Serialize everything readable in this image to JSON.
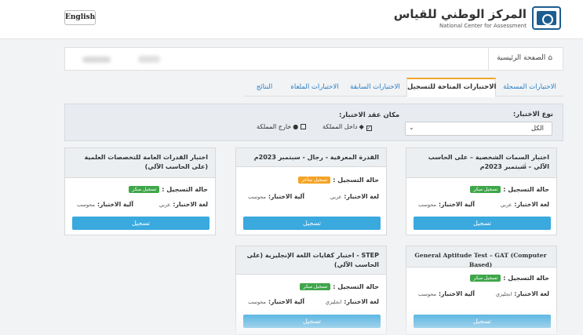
{
  "header": {
    "lang_button": "English",
    "logo_ar": "المركز الوطني للقياس",
    "logo_en": "National Center for Assessment"
  },
  "breadcrumb": {
    "home": "الصفحة الرئيسية",
    "icon": "home-icon"
  },
  "tabs": [
    {
      "label": "الاختبارات المسجلة",
      "active": false
    },
    {
      "label": "الاختبارات المتاحة للتسجيل",
      "active": true
    },
    {
      "label": "الاختبارات السابقة",
      "active": false
    },
    {
      "label": "الاختبارات الملغاة",
      "active": false
    },
    {
      "label": "النتائج",
      "active": false
    }
  ],
  "filter": {
    "type_label": "نوع الاختبار:",
    "type_value": "الكل",
    "place_label": "مكان عقد الاختبار:",
    "inside": "داخل المملكة",
    "outside": "خارج المملكة"
  },
  "labels": {
    "status": "حالة التسجيل :",
    "language": "لغة الاختبار:",
    "mechanism": "آلية الاختبار:",
    "register": "تسجيل"
  },
  "cards": [
    {
      "title": "اختبار السمات الشخصية – على الحاسب الآلي – سبتمبر 2023م",
      "status": "تسجيل مبكر",
      "language": "عربي",
      "mechanism": "محوسب"
    },
    {
      "title": "القدرة المعرفية - رجال - سبتمبر 2023م",
      "status": "تسجيل متأخر",
      "language": "عربي",
      "mechanism": "محوسب"
    },
    {
      "title": "اختبار القدرات العامة للتخصصات العلمية (على الحاسب الآلي)",
      "status": "تسجيل مبكر",
      "language": "عربي",
      "mechanism": "محوسب"
    },
    {
      "title": "General Aptitude Test – GAT (Computer Based)",
      "status": "تسجيل مبكر",
      "language": "انجليزي",
      "mechanism": "محوسب"
    },
    {
      "title": "STEP - اختبار كفايات اللغة الإنجليزية (على الحاسب الآلي)",
      "status": "تسجيل مبكر",
      "language": "انجليزي",
      "mechanism": "محوسب"
    }
  ],
  "colors": {
    "accent": "#1f7bc4",
    "button": "#3aa9de",
    "early": "#3fa64a",
    "late": "#f4a326",
    "tab_highlight": "#f0a429"
  }
}
